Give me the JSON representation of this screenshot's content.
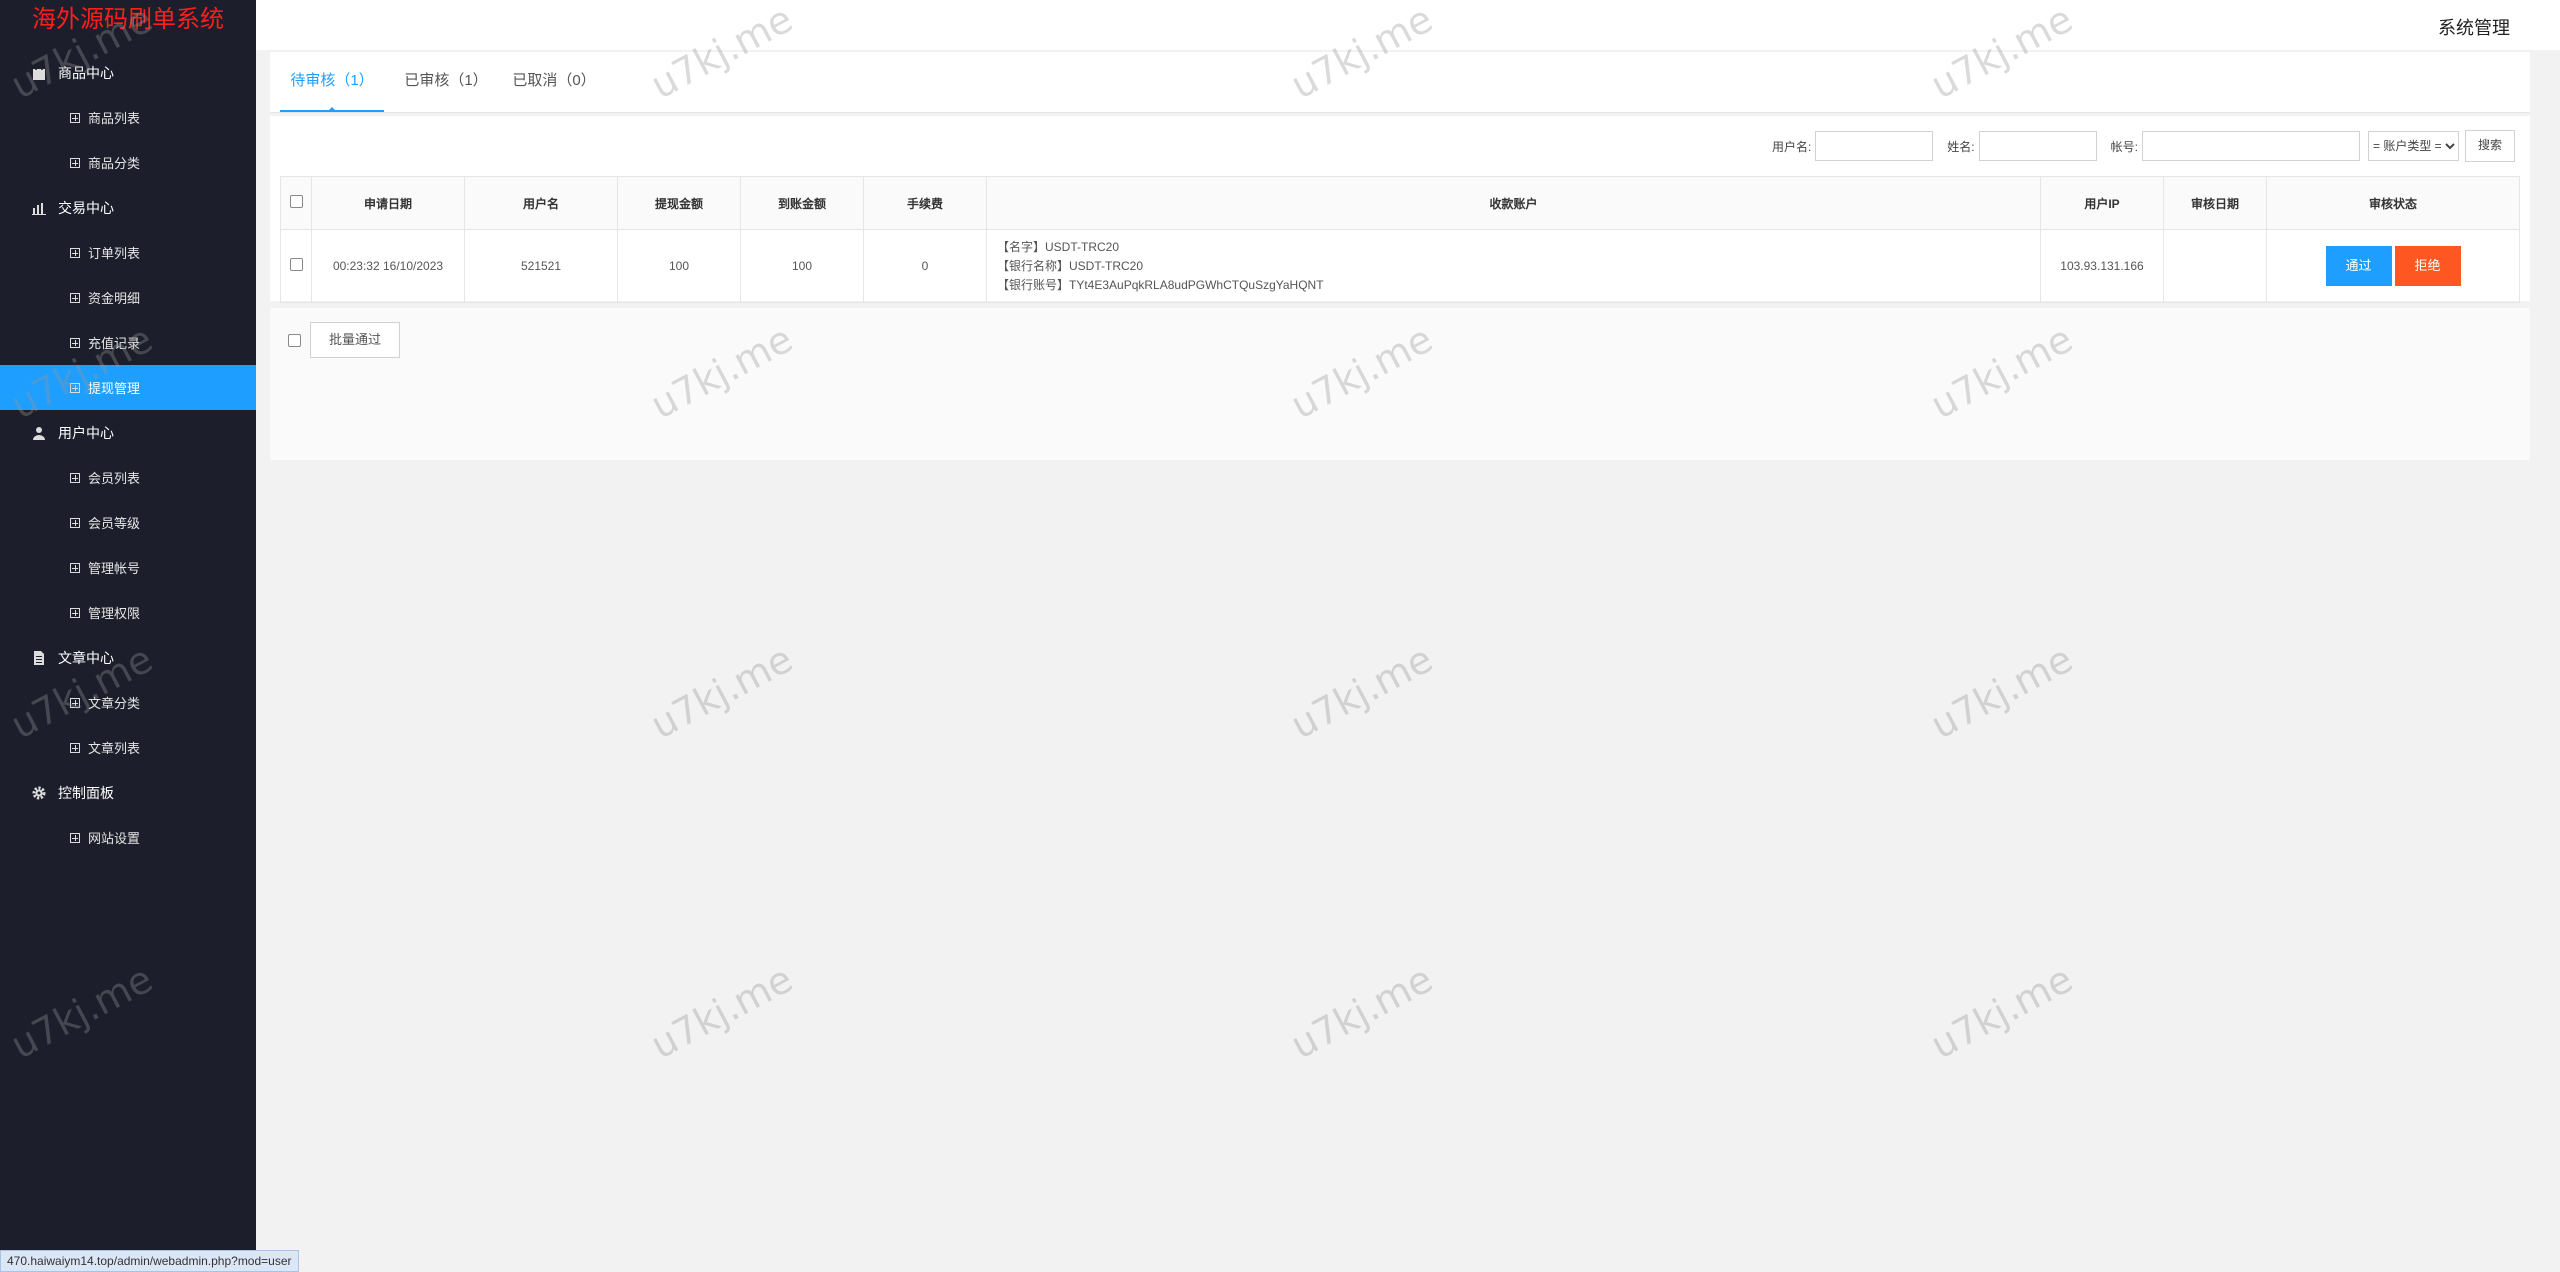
{
  "brand": {
    "title": "海外源码刷单系统",
    "color": "#ff1e1e"
  },
  "header": {
    "system_label": "系统管理"
  },
  "sidebar": {
    "accent": "#1e9fff",
    "groups": [
      {
        "label": "商品中心",
        "icon": "shopping-bag-icon",
        "items": [
          {
            "label": "商品列表"
          },
          {
            "label": "商品分类"
          }
        ]
      },
      {
        "label": "交易中心",
        "icon": "bar-chart-icon",
        "items": [
          {
            "label": "订单列表"
          },
          {
            "label": "资金明细"
          },
          {
            "label": "充值记录"
          },
          {
            "label": "提现管理",
            "active": true
          }
        ]
      },
      {
        "label": "用户中心",
        "icon": "user-icon",
        "items": [
          {
            "label": "会员列表"
          },
          {
            "label": "会员等级"
          },
          {
            "label": "管理帐号"
          },
          {
            "label": "管理权限"
          }
        ]
      },
      {
        "label": "文章中心",
        "icon": "document-icon",
        "items": [
          {
            "label": "文章分类"
          },
          {
            "label": "文章列表"
          }
        ]
      },
      {
        "label": "控制面板",
        "icon": "gear-icon",
        "items": [
          {
            "label": "网站设置"
          }
        ]
      }
    ]
  },
  "tabs": [
    {
      "label": "待审核（1）",
      "active": true
    },
    {
      "label": "已审核（1）"
    },
    {
      "label": "已取消（0）"
    }
  ],
  "search": {
    "username_label": "用户名:",
    "name_label": "姓名:",
    "account_label": "帐号:",
    "account_type_selected": "= 账户类型 =",
    "button_label": "搜索"
  },
  "table": {
    "columns": [
      "申请日期",
      "用户名",
      "提现金额",
      "到账金额",
      "手续费",
      "收款账户",
      "用户IP",
      "审核日期",
      "审核状态"
    ],
    "rows": [
      {
        "date": "00:23:32 16/10/2023",
        "username": "521521",
        "amount": "100",
        "received": "100",
        "fee": "0",
        "account_lines": [
          "【名字】USDT-TRC20",
          "【银行名称】USDT-TRC20",
          "【银行账号】TYt4E3AuPqkRLA8udPGWhCTQuSzgYaHQNT"
        ],
        "ip": "103.93.131.166",
        "review_date": "",
        "approve_label": "通过",
        "reject_label": "拒绝"
      }
    ]
  },
  "batch": {
    "label": "批量通过"
  },
  "statusbar": {
    "url": "470.haiwaiym14.top/admin/webadmin.php?mod=user"
  },
  "watermark": "u7kj.me"
}
